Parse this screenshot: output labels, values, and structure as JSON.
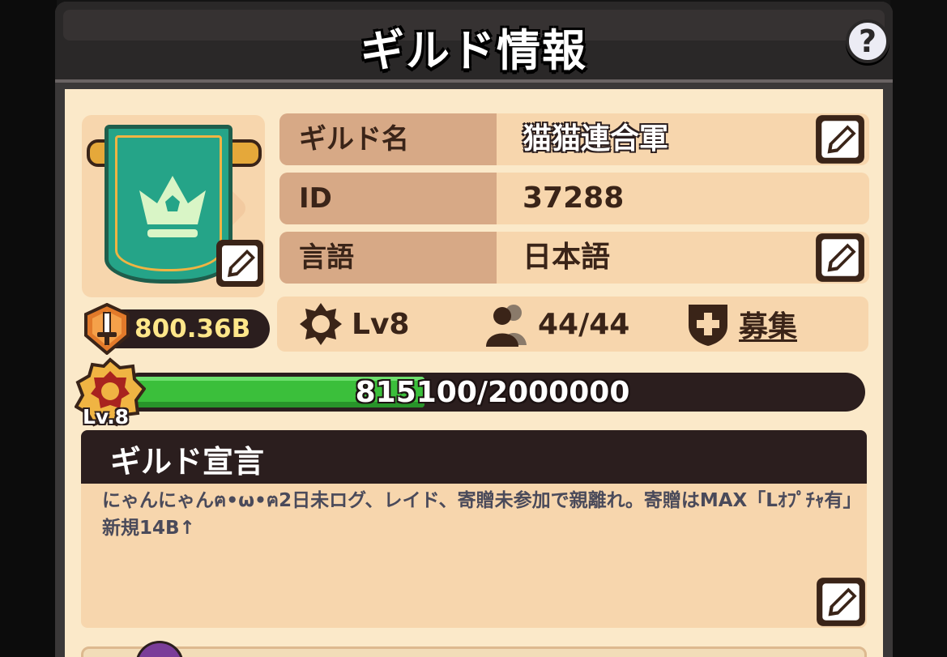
{
  "window": {
    "title": "ギルド情報",
    "help_label": "?"
  },
  "guild": {
    "emblem_icon": "crown-icon",
    "power": "800.36B",
    "name_label": "ギルド名",
    "name_value": "猫猫連合軍",
    "id_label": "ID",
    "id_value": "37288",
    "language_label": "言語",
    "language_value": "日本語",
    "level_text": "Lv8",
    "members_text": "44/44",
    "recruit_text": "募集"
  },
  "experience": {
    "current": 815100,
    "max": 2000000,
    "progress_text": "815100/2000000",
    "level_badge": "Lv.8"
  },
  "declaration": {
    "title": "ギルド宣言",
    "text": "にゃんにゃんฅ•ω•ฅ2日未ログ、レイド、寄贈未参加で親離れ。寄贈はMAX「Lｵﾌﾟﾁｬ有」新規14B↑"
  },
  "colors": {
    "panel": "#3a3838",
    "content_bg": "#fbe9c9",
    "label_bg": "#d7a986",
    "value_bg": "#f7d6ad",
    "dark": "#2b1e1e",
    "banner_green": "#25a488",
    "xp_green": "#3bbf3b",
    "power_yellow": "#ffe78a"
  }
}
